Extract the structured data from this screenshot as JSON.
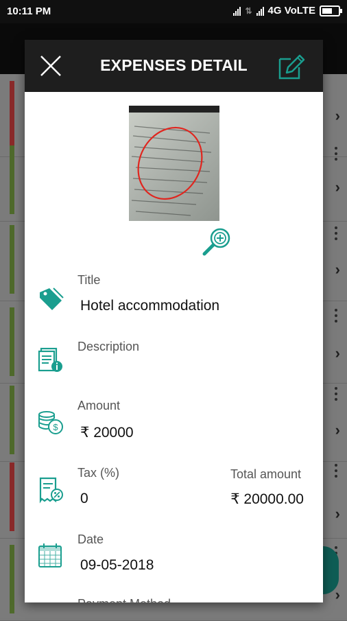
{
  "status_bar": {
    "time": "10:11 PM",
    "network": "4G VoLTE"
  },
  "dialog": {
    "title": "EXPENSES DETAIL",
    "close_icon": "close-icon",
    "edit_icon": "edit-icon",
    "zoom_icon": "zoom-in-icon"
  },
  "fields": {
    "title": {
      "label": "Title",
      "value": "Hotel accommodation",
      "icon": "tag-icon"
    },
    "description": {
      "label": "Description",
      "value": "",
      "icon": "document-info-icon"
    },
    "amount": {
      "label": "Amount",
      "value": "₹ 20000",
      "icon": "coins-icon"
    },
    "tax": {
      "label": "Tax (%)",
      "value": "0",
      "icon": "tax-receipt-icon"
    },
    "total": {
      "label": "Total amount",
      "value": "₹ 20000.00"
    },
    "date": {
      "label": "Date",
      "value": "09-05-2018",
      "icon": "calendar-icon"
    },
    "payment": {
      "label": "Payment Method"
    }
  },
  "colors": {
    "accent": "#1a9e8f",
    "header_bg": "#1e1e1e",
    "row_strip_green": "#4f8a1c",
    "row_strip_red": "#b32222"
  },
  "background_rows": [
    {
      "strip": "red"
    },
    {
      "strip": "green"
    },
    {
      "strip": "green"
    },
    {
      "strip": "green"
    },
    {
      "strip": "green"
    },
    {
      "strip": "red"
    },
    {
      "strip": "green"
    }
  ]
}
